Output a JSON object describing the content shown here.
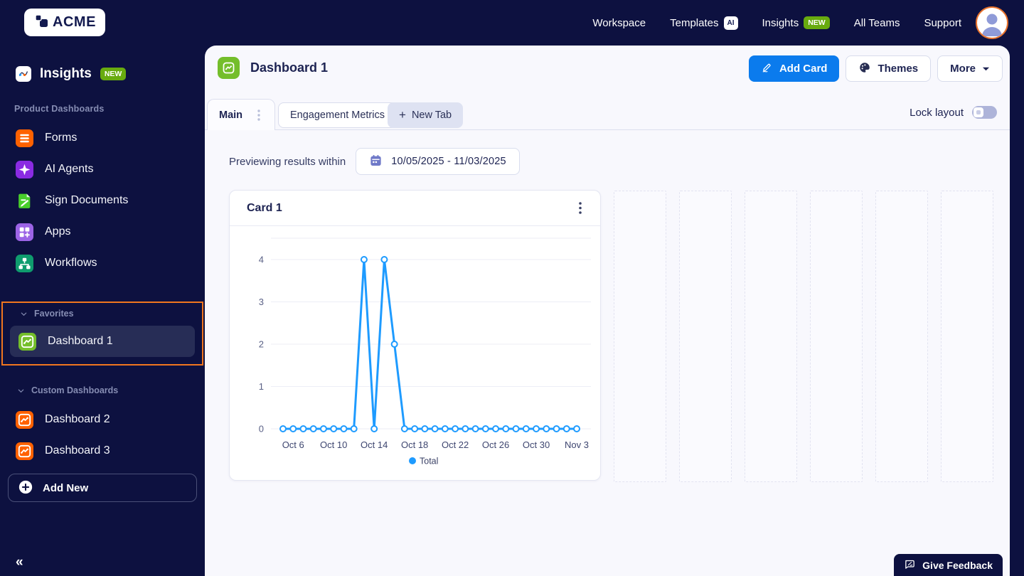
{
  "topnav": {
    "brand": "ACME",
    "links": [
      {
        "id": "workspace",
        "label": "Workspace"
      },
      {
        "id": "templates",
        "label": "Templates",
        "badge": "AI",
        "badge_style": "white"
      },
      {
        "id": "insights",
        "label": "Insights",
        "badge": "NEW",
        "badge_style": "green"
      },
      {
        "id": "all-teams",
        "label": "All Teams"
      },
      {
        "id": "support",
        "label": "Support"
      }
    ],
    "avatar_icon": "user-avatar-icon"
  },
  "sidebar": {
    "title": "Insights",
    "title_badge": "NEW",
    "title_icon": "insights-line-chart-icon",
    "sections": {
      "product": {
        "label": "Product Dashboards",
        "items": [
          {
            "id": "forms",
            "label": "Forms",
            "icon": "forms-icon",
            "icon_color": "#FF6100"
          },
          {
            "id": "ai-agents",
            "label": "AI Agents",
            "icon": "ai-agents-icon",
            "icon_color": "#8A2BE2"
          },
          {
            "id": "sign-documents",
            "label": "Sign Documents",
            "icon": "sign-documents-icon",
            "icon_color": "#48CE2B"
          },
          {
            "id": "apps",
            "label": "Apps",
            "icon": "apps-icon",
            "icon_color": "#9C64E6"
          },
          {
            "id": "workflows",
            "label": "Workflows",
            "icon": "workflows-icon",
            "icon_color": "#0F9C6E"
          }
        ]
      },
      "favorites": {
        "label": "Favorites",
        "highlight_color": "#F0761F",
        "items": [
          {
            "id": "dashboard-1",
            "label": "Dashboard 1",
            "icon": "dashboard-chart-icon",
            "icon_color": "#74BE2B",
            "selected": true
          }
        ]
      },
      "custom": {
        "label": "Custom Dashboards",
        "items": [
          {
            "id": "dashboard-2",
            "label": "Dashboard 2",
            "icon": "dashboard-chart-icon",
            "icon_color": "#FF6100"
          },
          {
            "id": "dashboard-3",
            "label": "Dashboard 3",
            "icon": "dashboard-chart-icon",
            "icon_color": "#FF6100"
          }
        ]
      }
    },
    "add_new_label": "Add New",
    "collapse_glyph": "«"
  },
  "main": {
    "title": "Dashboard 1",
    "title_icon_color": "#74BE2B",
    "buttons": {
      "add_card": "Add Card",
      "themes": "Themes",
      "more": "More"
    },
    "tabs": [
      {
        "id": "main",
        "label": "Main",
        "active": true
      },
      {
        "id": "engagement-metrics",
        "label": "Engagement Metrics",
        "active": false
      }
    ],
    "new_tab_plus": "+",
    "new_tab_label": "New Tab",
    "lock_layout_label": "Lock layout",
    "lock_layout_on": false,
    "preview_label": "Previewing results within",
    "date_range": "10/05/2025 - 11/03/2025",
    "empty_grid_slots": 6,
    "feedback_button": "Give Feedback"
  },
  "card": {
    "title": "Card 1"
  },
  "chart_data": {
    "type": "line",
    "title": "Card 1",
    "x": [
      "Oct 5",
      "Oct 6",
      "Oct 7",
      "Oct 8",
      "Oct 9",
      "Oct 10",
      "Oct 11",
      "Oct 12",
      "Oct 13",
      "Oct 14",
      "Oct 15",
      "Oct 16",
      "Oct 17",
      "Oct 18",
      "Oct 19",
      "Oct 20",
      "Oct 21",
      "Oct 22",
      "Oct 23",
      "Oct 24",
      "Oct 25",
      "Oct 26",
      "Oct 27",
      "Oct 28",
      "Oct 29",
      "Oct 30",
      "Oct 31",
      "Nov 1",
      "Nov 2",
      "Nov 3"
    ],
    "series": [
      {
        "name": "Total",
        "color": "#1E9BFF",
        "values": [
          0,
          0,
          0,
          0,
          0,
          0,
          0,
          0,
          4,
          0,
          4,
          2,
          0,
          0,
          0,
          0,
          0,
          0,
          0,
          0,
          0,
          0,
          0,
          0,
          0,
          0,
          0,
          0,
          0,
          0
        ]
      }
    ],
    "xticks": {
      "labels": [
        "Oct 6",
        "Oct 10",
        "Oct 14",
        "Oct 18",
        "Oct 22",
        "Oct 26",
        "Oct 30",
        "Nov 3"
      ],
      "indices": [
        1,
        5,
        9,
        13,
        17,
        21,
        25,
        29
      ]
    },
    "yticks": [
      0,
      1,
      2,
      3,
      4
    ],
    "ylim": [
      0,
      4
    ],
    "grid": true,
    "legend_position": "bottom",
    "marker": "open-circle"
  },
  "colors": {
    "navy": "#0D1140",
    "panel_bg": "#F8F8FD",
    "accent_blue": "#0B7BED",
    "chart_blue": "#1E9BFF",
    "green_badge": "#68AB0F",
    "orange_highlight": "#F0761F",
    "border": "#DCDFEE"
  }
}
